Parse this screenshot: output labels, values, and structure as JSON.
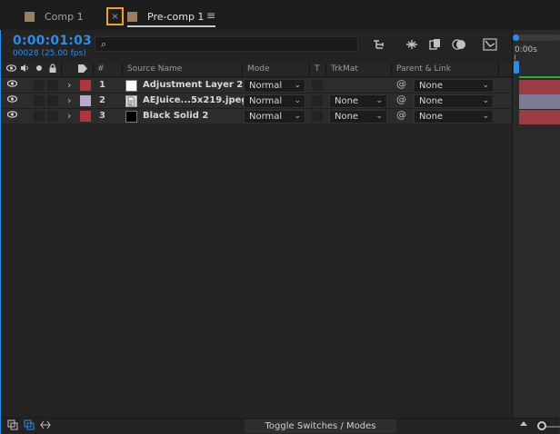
{
  "tabs": [
    {
      "label": "Comp 1"
    },
    {
      "label": "Pre-comp 1"
    }
  ],
  "tab_close_glyph": "×",
  "tab_menu_glyph": "≡",
  "timecode": "0:00:01:03",
  "frame_info": "00028 (25.00 fps)",
  "search_glyph": "⌕",
  "toolbar_icons": [
    "composition-mini-flowchart-icon",
    "draft-3d-icon",
    "frame-blending-icon",
    "motion-blur-icon",
    "graph-editor-icon"
  ],
  "columns": {
    "label_hash": "#",
    "source_name": "Source Name",
    "mode": "Mode",
    "t": "T",
    "trkmat": "TrkMat",
    "parent_link": "Parent & Link"
  },
  "timeline": {
    "ruler_label": "0:00s"
  },
  "layers": [
    {
      "number": "1",
      "name": "Adjustment Layer 2",
      "mode": "Normal",
      "trkmat": "",
      "parent": "None",
      "label_color": "#b0353e",
      "thumb_color": "#ffffff"
    },
    {
      "number": "2",
      "name": "AEJuice...5x219.jpeg",
      "mode": "Normal",
      "trkmat": "None",
      "parent": "None",
      "label_color": "#b7a9d0",
      "thumb_color": "#e8e8e8"
    },
    {
      "number": "3",
      "name": "Black Solid 2",
      "mode": "Normal",
      "trkmat": "None",
      "parent": "None",
      "label_color": "#b0353e",
      "thumb_color": "#000000"
    }
  ],
  "footer": {
    "toggle_label": "Toggle Switches / Modes"
  },
  "colors": {
    "accent": "#2d8ceb",
    "highlight": "#f0a030",
    "green_track": "#21b032"
  }
}
